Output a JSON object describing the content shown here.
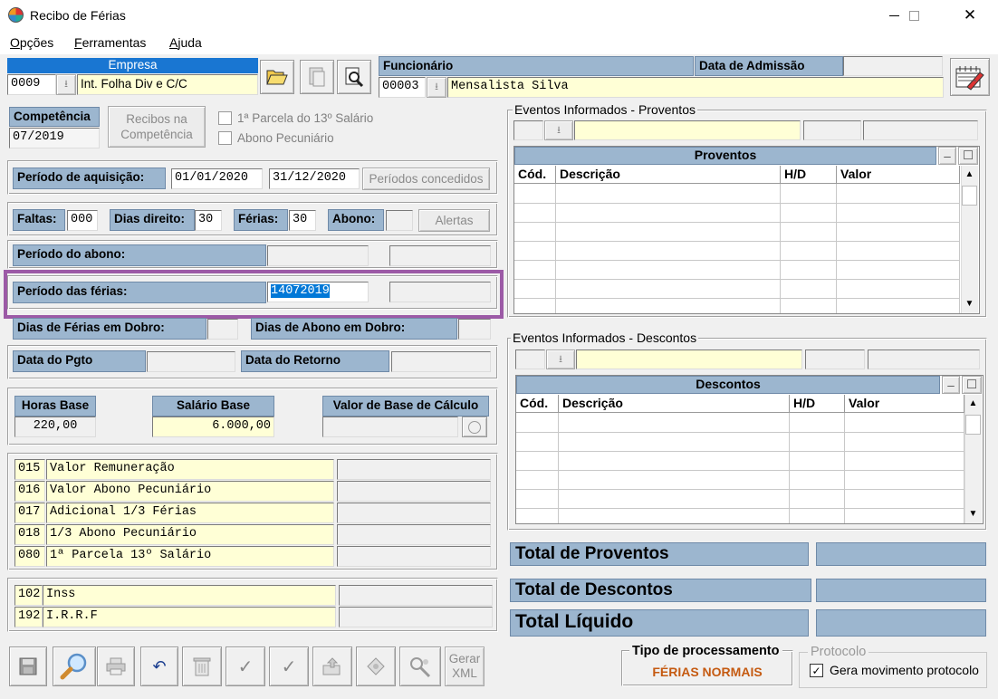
{
  "window": {
    "title": "Recibo de Férias",
    "minimize": "—",
    "maximize": "☐",
    "close": "✕"
  },
  "menu": [
    "Opções",
    "Ferramentas",
    "Ajuda"
  ],
  "empresa": {
    "label": "Empresa",
    "code": "0009",
    "name": "Int. Folha Div e C/C"
  },
  "funcionario": {
    "label": "Funcionário",
    "code": "00003",
    "name": "Mensalista Silva",
    "admissao_label": "Data de Admissão",
    "admissao_value": ""
  },
  "competencia": {
    "label": "Competência",
    "value": "07/2019",
    "recibos_button": "Recibos na\nCompetência"
  },
  "checkboxes": {
    "parcela": "1ª Parcela do 13º Salário",
    "abono": "Abono Pecuniário"
  },
  "aquisicao": {
    "label": "Período de aquisição:",
    "start": "01/01/2020",
    "end": "31/12/2020",
    "button": "Períodos concedidos"
  },
  "faltas": {
    "faltas_label": "Faltas:",
    "faltas_value": "000",
    "dias_label": "Dias direito:",
    "dias_value": "30",
    "ferias_label": "Férias:",
    "ferias_value": "30",
    "abono_label": "Abono:",
    "abono_value": "",
    "alertas": "Alertas"
  },
  "periodo_abono": {
    "label": "Período do abono:"
  },
  "periodo_ferias": {
    "label": "Período das férias:",
    "value": "14072019"
  },
  "dobro": {
    "ferias_label": "Dias de Férias em Dobro:",
    "abono_label": "Dias de Abono em Dobro:"
  },
  "datas": {
    "pgto_label": "Data do Pgto",
    "retorno_label": "Data do Retorno"
  },
  "bases": {
    "horas_label": "Horas Base",
    "horas_value": "220,00",
    "salario_label": "Salário Base",
    "salario_value": "6.000,00",
    "valor_label": "Valor de Base de Cálculo",
    "valor_value": ""
  },
  "proventos_list": [
    {
      "code": "015",
      "desc": "Valor Remuneração"
    },
    {
      "code": "016",
      "desc": "Valor Abono Pecuniário"
    },
    {
      "code": "017",
      "desc": "Adicional 1/3 Férias"
    },
    {
      "code": "018",
      "desc": "1/3 Abono Pecuniário"
    },
    {
      "code": "080",
      "desc": "1ª Parcela 13º Salário"
    }
  ],
  "descontos_list": [
    {
      "code": "102",
      "desc": "Inss"
    },
    {
      "code": "192",
      "desc": "I.R.R.F"
    }
  ],
  "eventos_proventos": {
    "group": "Eventos Informados - Proventos",
    "title": "Proventos",
    "cols": [
      "Cód.",
      "Descrição",
      "H/D",
      "Valor"
    ]
  },
  "eventos_descontos": {
    "group": "Eventos Informados - Descontos",
    "title": "Descontos",
    "cols": [
      "Cód.",
      "Descrição",
      "H/D",
      "Valor"
    ]
  },
  "totais": {
    "proventos": "Total de Proventos",
    "descontos": "Total de Descontos",
    "liquido": "Total Líquido"
  },
  "processamento": {
    "label": "Tipo de processamento",
    "value": "FÉRIAS NORMAIS"
  },
  "protocolo": {
    "label": "Protocolo",
    "checkbox": "Gera movimento protocolo",
    "checked": "✓"
  },
  "toolbar": {
    "gerar_xml": "Gerar\nXML"
  },
  "icons": {
    "processamento_color": "#c55a11",
    "highlight_color": "#9c5aa6",
    "label_bg": "#9cb6cf"
  }
}
